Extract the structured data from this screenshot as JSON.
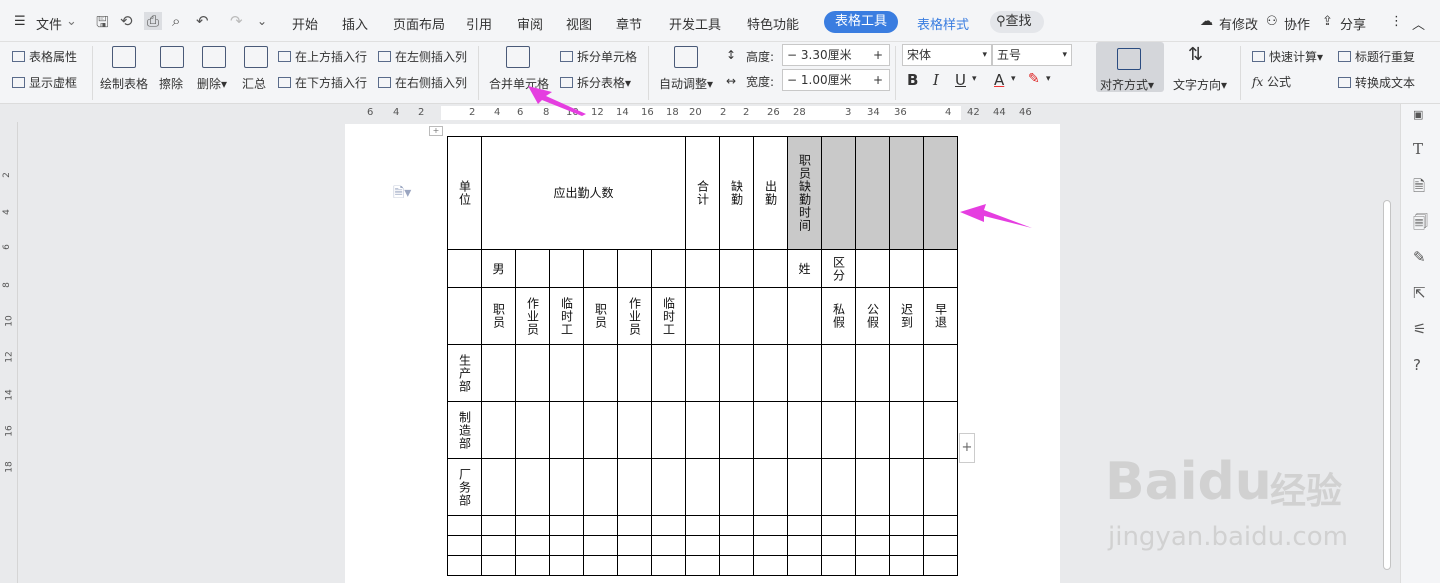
{
  "menubar": {
    "file": "文件",
    "tabs": [
      "开始",
      "插入",
      "页面布局",
      "引用",
      "审阅",
      "视图",
      "章节",
      "开发工具",
      "特色功能"
    ],
    "active_tab": "表格工具",
    "style_tab": "表格样式",
    "search": "查找",
    "modified": "有修改",
    "collab": "协作",
    "share": "分享"
  },
  "ribbon": {
    "table_props": "表格属性",
    "show_gridlines": "显示虚框",
    "draw_table": "绘制表格",
    "erase": "擦除",
    "delete": "删除",
    "summary": "汇总",
    "insert_above": "在上方插入行",
    "insert_below": "在下方插入行",
    "insert_left": "在左侧插入列",
    "insert_right": "在右侧插入列",
    "merge_cells": "合并单元格",
    "split_cells": "拆分单元格",
    "split_table": "拆分表格",
    "auto_fit": "自动调整",
    "height_label": "高度:",
    "height_value": "3.30厘米",
    "width_label": "宽度:",
    "width_value": "1.00厘米",
    "font_name": "宋体",
    "font_size": "五号",
    "align": "对齐方式",
    "text_dir": "文字方向",
    "quick_calc": "快速计算",
    "repeat_header": "标题行重复",
    "formula": "公式",
    "to_text": "转换成文本"
  },
  "ruler_ticks": [
    "6",
    "4",
    "2",
    "2",
    "4",
    "6",
    "8",
    "10",
    "12",
    "14",
    "16",
    "18",
    "20",
    "2",
    "2",
    "26",
    "28",
    "3",
    "34",
    "36",
    "4",
    "42",
    "44",
    "46"
  ],
  "vruler_ticks": [
    "2",
    "4",
    "6",
    "8",
    "10",
    "12",
    "14",
    "16",
    "18"
  ],
  "table": {
    "r1": {
      "unit": "单位",
      "should_attend": "应出勤人数",
      "total": "合计",
      "absent": "缺勤",
      "present": "出勤",
      "staff_absent_time": "职员缺勤时间"
    },
    "r2": {
      "male": "男",
      "surname": "姓",
      "category": "区分"
    },
    "r3": [
      "职员",
      "作业员",
      "临时工",
      "职员",
      "作业员",
      "临时工"
    ],
    "r3_right": [
      "私假",
      "公假",
      "迟到",
      "早退"
    ],
    "depts": [
      "生产部",
      "制造部",
      "厂务部"
    ]
  },
  "watermark": {
    "brand": "Baidu",
    "cn": "经验",
    "url": "jingyan.baidu.com"
  }
}
